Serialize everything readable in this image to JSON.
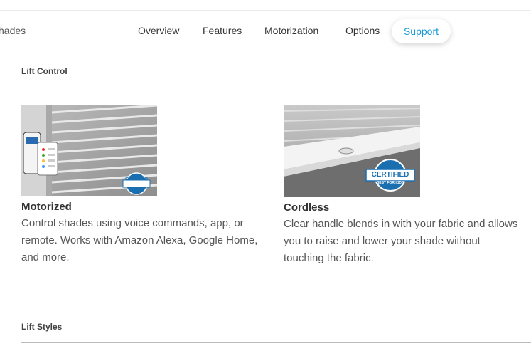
{
  "nav": {
    "brand_partial": "hades",
    "items": [
      "Overview",
      "Features",
      "Motorization",
      "Options"
    ],
    "active_item": "Support",
    "accent_color": "#1d9bd7"
  },
  "lift_control": {
    "heading": "Lift Control",
    "cards": [
      {
        "title": "Motorized",
        "description": "Control shades using voice commands, app, or remote. Works with Amazon Alexa, Google Home, and more.",
        "badge_text": "CERTIFIED",
        "badge_subtext": "BEST FOR KIDS"
      },
      {
        "title": "Cordless",
        "description": "Clear handle blends in with your fabric and allows you to raise and lower your shade without touching the fabric.",
        "badge_text": "CERTIFIED",
        "badge_subtext": "BEST FOR KIDS"
      }
    ]
  },
  "lift_styles": {
    "heading": "Lift Styles"
  }
}
